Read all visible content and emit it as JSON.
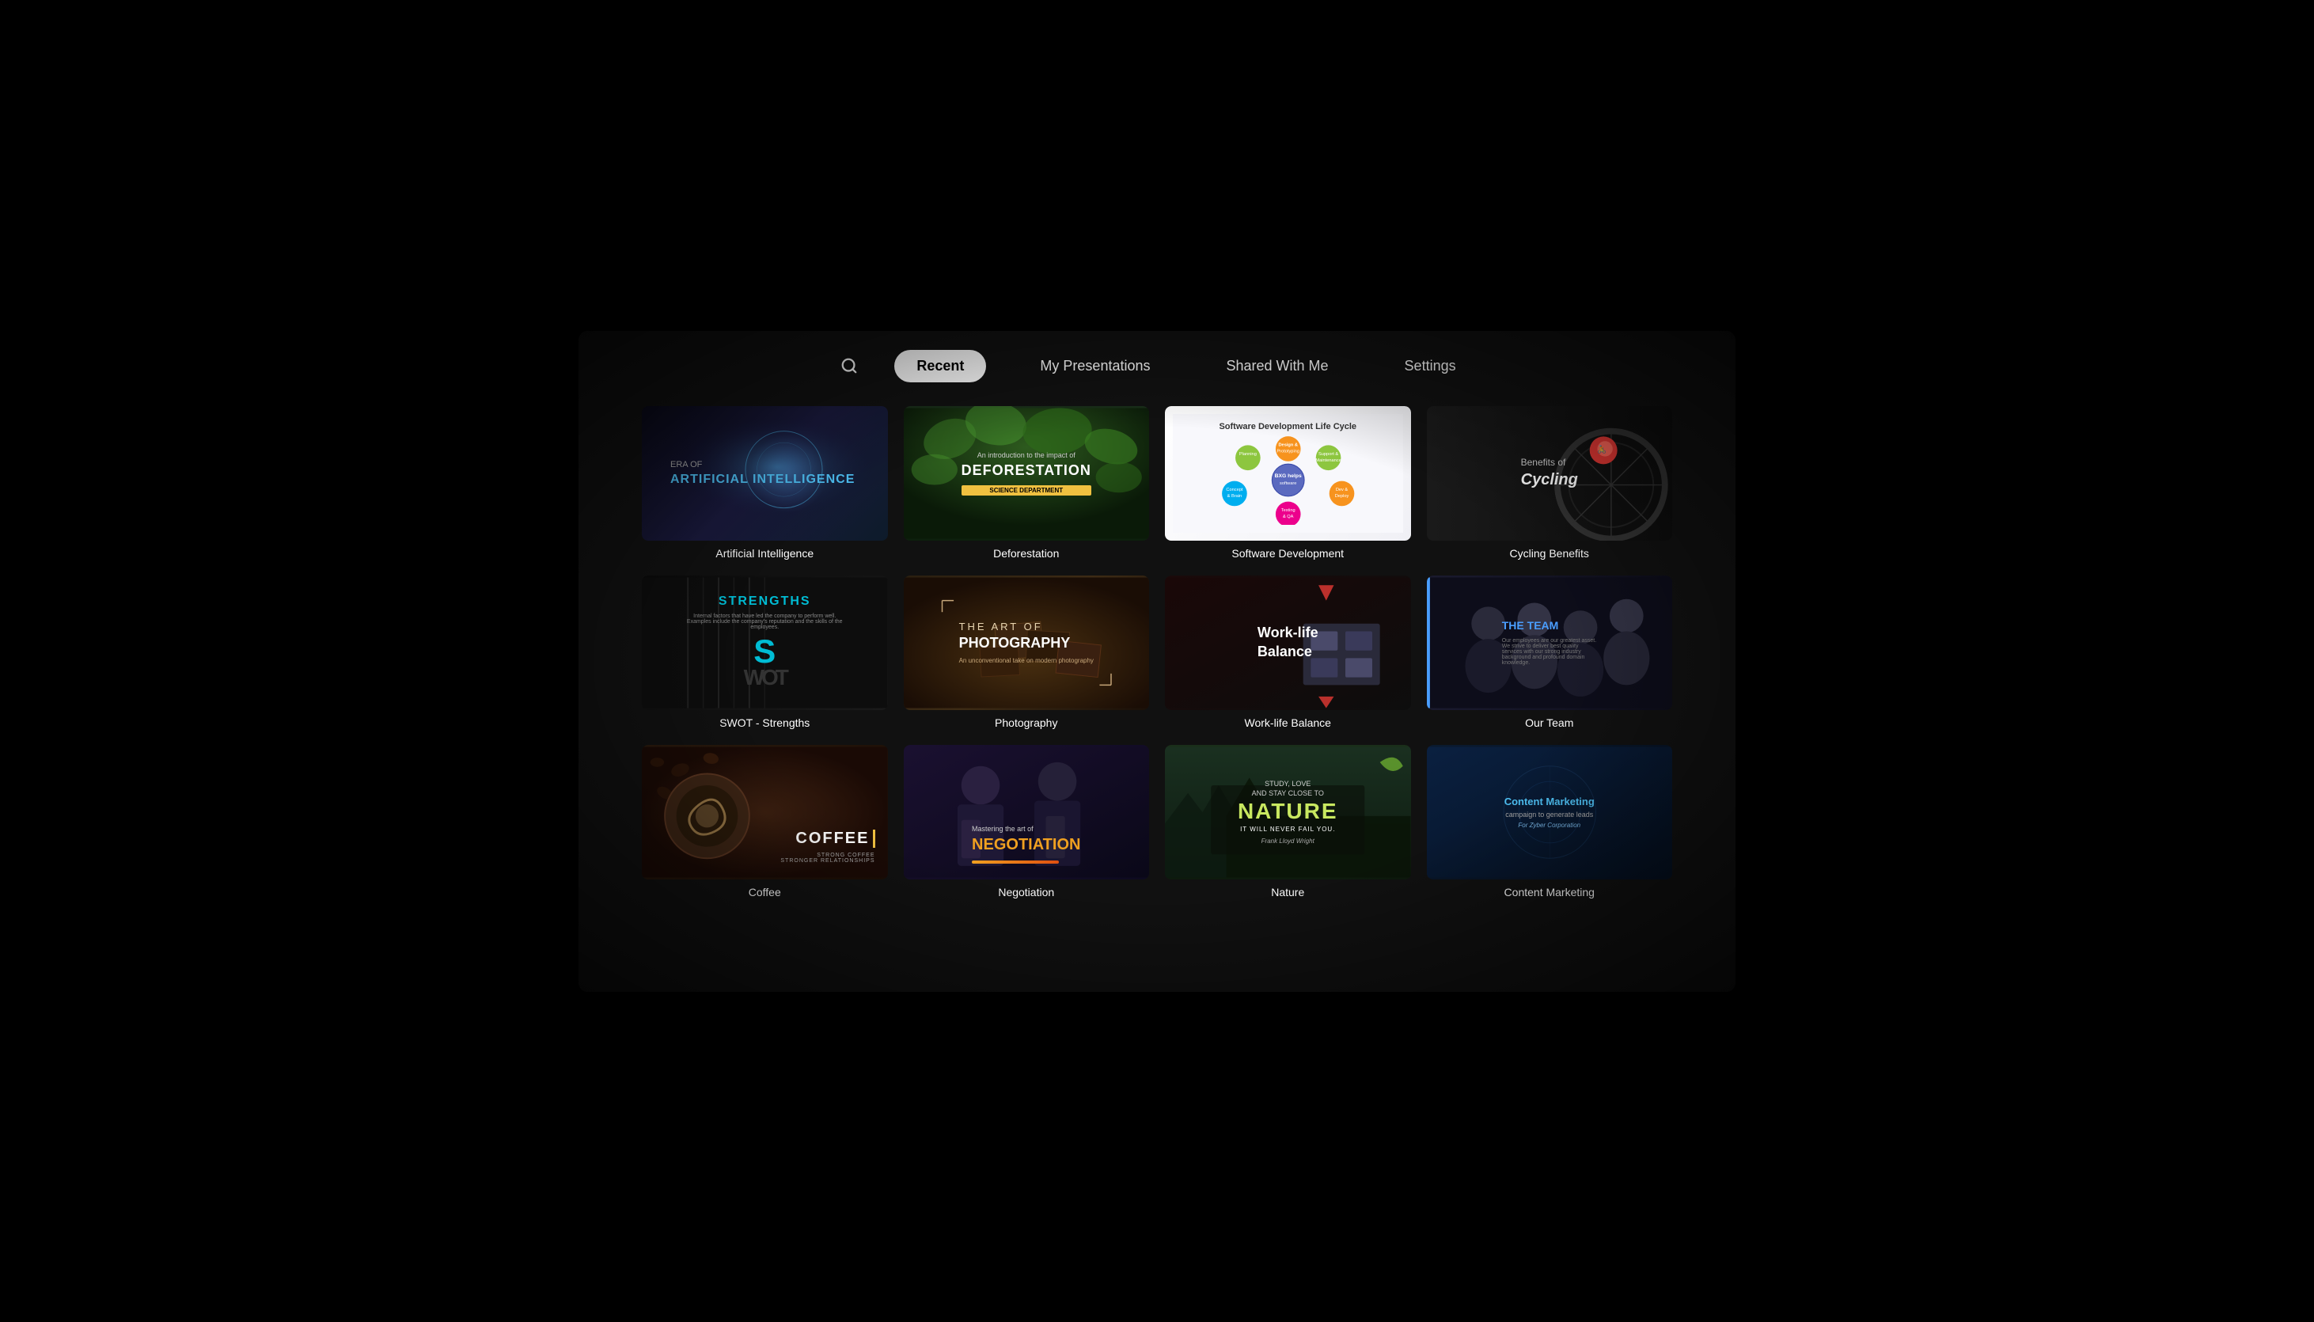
{
  "nav": {
    "tabs": [
      {
        "id": "recent",
        "label": "Recent",
        "active": true
      },
      {
        "id": "my-presentations",
        "label": "My Presentations",
        "active": false
      },
      {
        "id": "shared-with-me",
        "label": "Shared With Me",
        "active": false
      },
      {
        "id": "settings",
        "label": "Settings",
        "active": false
      }
    ]
  },
  "cards": [
    {
      "id": "ai",
      "title": "Artificial Intelligence",
      "era": "ERA OF",
      "subtitle": "ARTIFICIAL INTELLIGENCE"
    },
    {
      "id": "deforestation",
      "title": "Deforestation",
      "intro": "An introduction to the impact of",
      "main": "DEFORESTATION",
      "badge": "SCIENCE DEPARTMENT"
    },
    {
      "id": "software",
      "title": "Software Development",
      "heading": "Software Development Life Cycle"
    },
    {
      "id": "cycling",
      "title": "Cycling Benefits",
      "label": "Benefits of",
      "italic": "Cycling"
    },
    {
      "id": "swot",
      "title": "SWOT - Strengths",
      "keyword": "STRENGTHS"
    },
    {
      "id": "photography",
      "title": "Photography",
      "art": "THE ART OF",
      "main": "PHOTOGRAPHY",
      "sub": "An unconventional take on modern photography"
    },
    {
      "id": "worklife",
      "title": "Work-life Balance",
      "line1": "Work-life",
      "line2": "Balance"
    },
    {
      "id": "ourteam",
      "title": "Our Team",
      "label": "THE TEAM"
    },
    {
      "id": "coffee",
      "title": "Coffee",
      "main": "COFFEE",
      "sub": "STRONG COFFEE\nSTRONGER RELATIONSHIPS"
    },
    {
      "id": "negotiation",
      "title": "Negotiation",
      "intro": "Mastering the art of",
      "main": "NEGOTIATION"
    },
    {
      "id": "nature",
      "title": "Nature",
      "text1": "STUDY, LOVE",
      "text2": "AND STAY CLOSE TO",
      "main": "NATURE",
      "tagline": "IT WILL NEVER FAIL YOU.",
      "author": "Frank Lloyd Wright"
    },
    {
      "id": "contentmarketing",
      "title": "Content Marketing",
      "line1": "Content Marketing",
      "line2": "campaign to generate leads",
      "company": "For Zyber Corporation"
    }
  ],
  "circles": [
    {
      "label": "Design &\nPrototyping",
      "color": "#f7931e"
    },
    {
      "label": "Support &\nMaintenance",
      "color": "#8dc63f"
    },
    {
      "label": "Development\n& Deployment",
      "color": "#f7931e"
    },
    {
      "label": "Concept &\nBrainstorming",
      "color": "#00aeef"
    },
    {
      "label": "Testing &\nQA",
      "color": "#ec008c"
    },
    {
      "label": "Planning",
      "color": "#8dc63f"
    }
  ]
}
